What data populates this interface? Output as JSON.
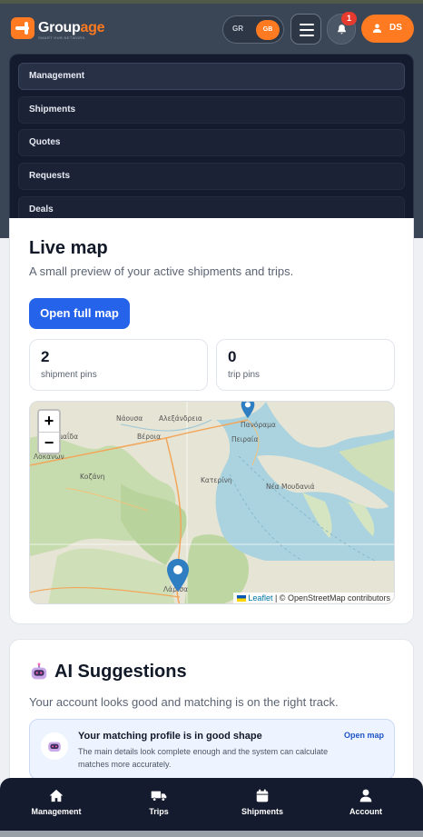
{
  "header": {
    "logo_text_part1": "Group",
    "logo_text_part2": "age",
    "logo_tagline": "SMART HUB NETWORK",
    "lang_options": [
      "GR",
      "GB"
    ],
    "lang_selected": "GB",
    "notification_count": "1",
    "account_initials": "DS",
    "icons": [
      "menu-icon",
      "bell-icon",
      "user-icon"
    ]
  },
  "dropdown": {
    "items": [
      {
        "label": "Management",
        "active": true
      },
      {
        "label": "Shipments",
        "active": false
      },
      {
        "label": "Quotes",
        "active": false
      },
      {
        "label": "Requests",
        "active": false
      },
      {
        "label": "Deals",
        "active": false
      }
    ]
  },
  "live_map": {
    "title": "Live map",
    "subtitle": "A small preview of your active shipments and trips.",
    "open_button": "Open full map",
    "stats": [
      {
        "value": "2",
        "label": "shipment pins"
      },
      {
        "value": "0",
        "label": "trip pins"
      }
    ],
    "zoom_in": "+",
    "zoom_out": "−",
    "attribution_link": "Leaflet",
    "attribution_text": "| © OpenStreetMap contributors",
    "places": [
      "Νάουσα",
      "Αλεξάνδρεια",
      "Πανόραμα",
      "Πτολεμαΐδα",
      "Βέροια",
      "Πειραία",
      "Λοκάνων",
      "Κοζάνη",
      "Κατερίνη",
      "Νέα Μουδανιά",
      "Λάρισα"
    ]
  },
  "ai": {
    "title": "AI Suggestions",
    "subtitle": "Your account looks good and matching is on the right track.",
    "item_title": "Your matching profile is in good shape",
    "item_desc": "The main details look complete enough and the system can calculate matches more accurately.",
    "item_link": "Open map"
  },
  "bottom_nav": [
    {
      "label": "Management",
      "icon": "home-icon"
    },
    {
      "label": "Trips",
      "icon": "truck-icon"
    },
    {
      "label": "Shipments",
      "icon": "calendar-icon"
    },
    {
      "label": "Account",
      "icon": "user-icon"
    }
  ],
  "colors": {
    "accent_orange": "#ff7a20",
    "primary_blue": "#2563eb",
    "nav_dark": "#151b2e",
    "badge_red": "#e63b2e"
  }
}
